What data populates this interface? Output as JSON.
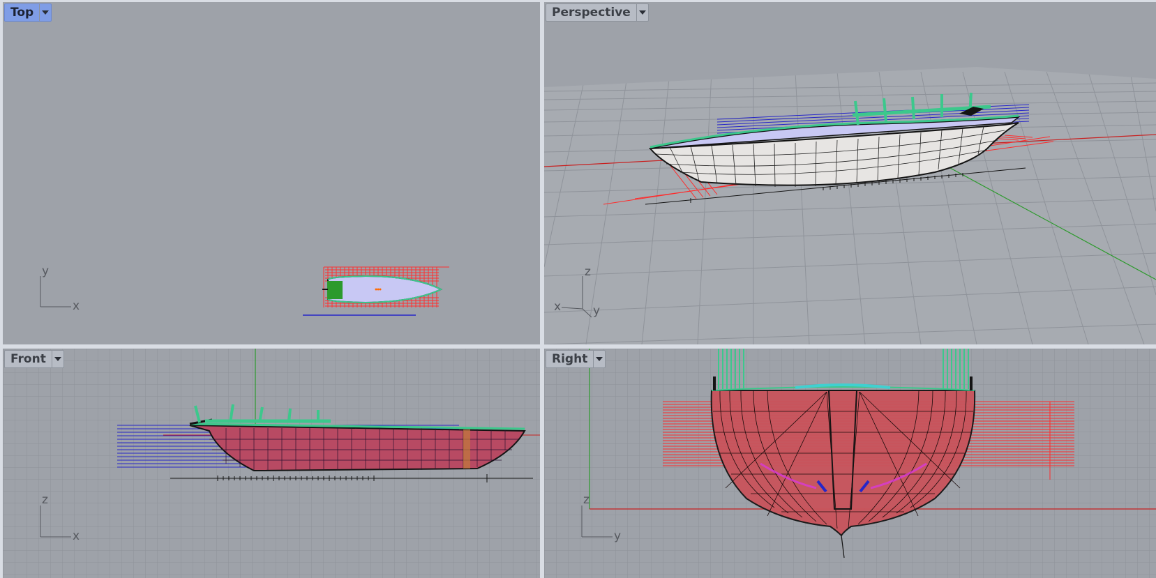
{
  "viewports": {
    "top": {
      "title": "Top",
      "axis_h": "x",
      "axis_v": "y",
      "active": true
    },
    "perspective": {
      "title": "Perspective",
      "axis_x": "x",
      "axis_y": "y",
      "axis_z": "z"
    },
    "front": {
      "title": "Front",
      "axis_h": "x",
      "axis_v": "z"
    },
    "right": {
      "title": "Right",
      "axis_h": "y",
      "axis_v": "z"
    }
  },
  "icons": {
    "viewport_menu": "chevron-down-icon"
  },
  "colors": {
    "background": "#9ea2a9",
    "grid": "#8e9299",
    "active_tab": "#7f9de6",
    "x_axis": "#c82020",
    "y_axis": "#2c9a2c",
    "hull_wire": "#141414",
    "hull_fill": "#c9545c",
    "deck": "#c8c8f4",
    "stations_red": "#ff2b2b",
    "waterlines_blue": "#2626c8",
    "masts_green": "#3cc88c"
  }
}
